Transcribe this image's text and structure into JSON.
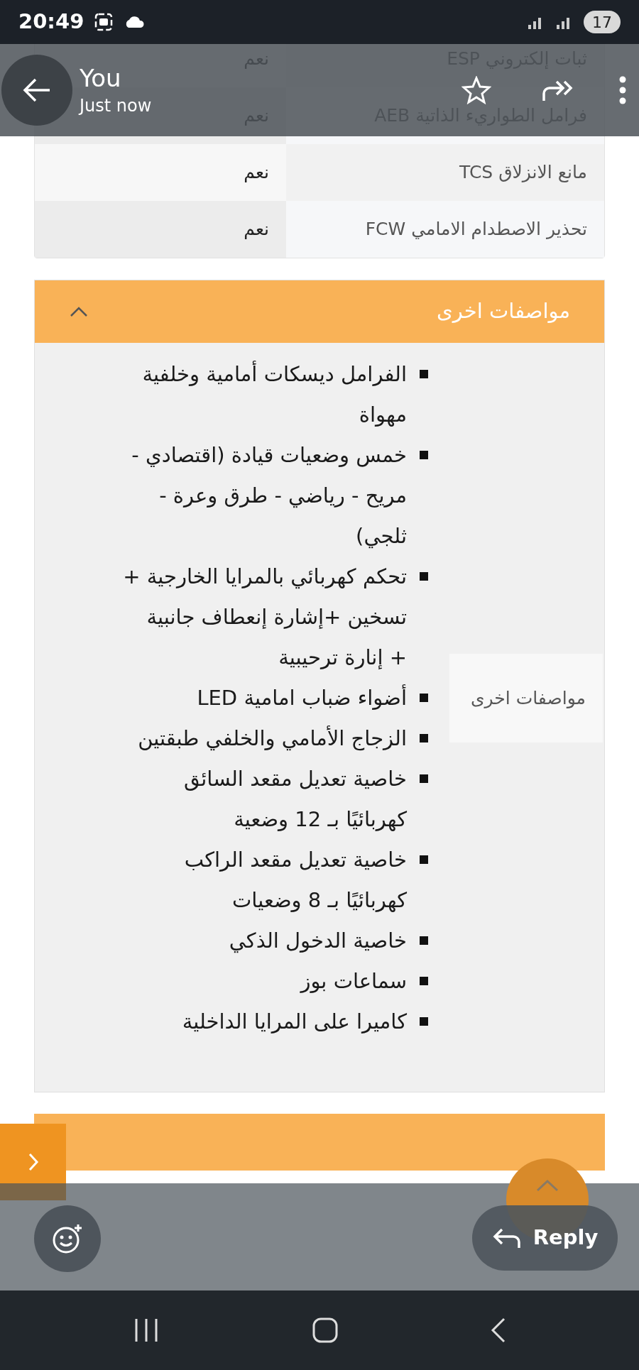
{
  "status_bar": {
    "time": "20:49",
    "battery": "17"
  },
  "message_header": {
    "sender": "You",
    "time": "Just now"
  },
  "specs_table": {
    "rows": [
      {
        "label": "ثبات إلكتروني ESP",
        "value": "نعم"
      },
      {
        "label": "فرامل الطواريء الذاتية AEB",
        "value": "نعم"
      },
      {
        "label": "مانع الانزلاق TCS",
        "value": "نعم"
      },
      {
        "label": "تحذير الاصطدام الامامي FCW",
        "value": "نعم"
      }
    ]
  },
  "section": {
    "title": "مواصفات اخرى",
    "expanded": true,
    "label": "مواصفات اخرى",
    "items": [
      "الفرامل ديسكات أمامية وخلفية مهواة",
      "خمس وضعيات قيادة (اقتصادي - مريح - رياضي - طرق وعرة - ثلجي)",
      "تحكم كهربائي بالمرايا الخارجية + تسخين +إشارة إنعطاف جانبية + إنارة ترحيبية",
      "أضواء ضباب امامية LED",
      "الزجاج الأمامي والخلفي طبقتين",
      "خاصية تعديل مقعد السائق كهربائيًا بـ 12 وضعية",
      "خاصية تعديل مقعد الراكب كهربائيًا بـ 8 وضعيات",
      "خاصية الدخول الذكي",
      "سماعات بوز",
      "كاميرا على المرايا الداخلية"
    ]
  },
  "reply_button": {
    "label": "Reply"
  }
}
